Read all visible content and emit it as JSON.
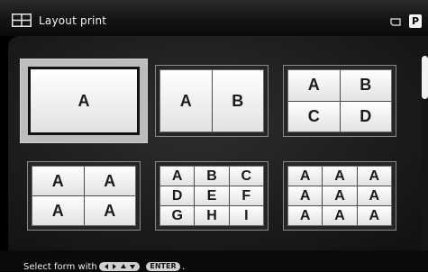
{
  "header": {
    "title": "Layout print",
    "badge": "P"
  },
  "forms": [
    {
      "cols": 1,
      "rows": 1,
      "labels": [
        "A"
      ]
    },
    {
      "cols": 2,
      "rows": 1,
      "labels": [
        "A",
        "B"
      ]
    },
    {
      "cols": 2,
      "rows": 2,
      "labels": [
        "A",
        "B",
        "C",
        "D"
      ]
    },
    {
      "cols": 2,
      "rows": 2,
      "labels": [
        "A",
        "A",
        "A",
        "A"
      ]
    },
    {
      "cols": 3,
      "rows": 3,
      "labels": [
        "A",
        "B",
        "C",
        "D",
        "E",
        "F",
        "G",
        "H",
        "I"
      ]
    },
    {
      "cols": 3,
      "rows": 3,
      "labels": [
        "A",
        "A",
        "A",
        "A",
        "A",
        "A",
        "A",
        "A",
        "A"
      ]
    }
  ],
  "selected_index": 0,
  "footer": {
    "hint": "Select form with",
    "enter_key": "ENTER",
    "end": "."
  }
}
